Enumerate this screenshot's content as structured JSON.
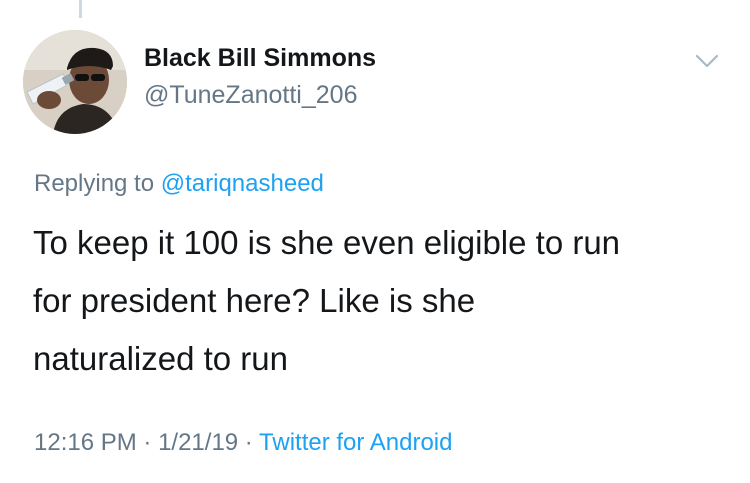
{
  "tweet": {
    "display_name": "Black Bill Simmons",
    "handle": "@TuneZanotti_206",
    "replying_prefix": "Replying to ",
    "replying_to": "@tariqnasheed",
    "text_lines": [
      "To keep it 100 is she even eligible to run",
      "for president here? Like is she",
      "naturalized to run"
    ],
    "time": "12:16 PM",
    "separator": " · ",
    "date": "1/21/19",
    "source": "Twitter for Android"
  },
  "icons": {
    "menu": "chevron-down-icon",
    "avatar": "profile-photo"
  },
  "colors": {
    "text": "#14171a",
    "secondary": "#657786",
    "link": "#1da1f2",
    "thread_line": "#cfd9de"
  }
}
